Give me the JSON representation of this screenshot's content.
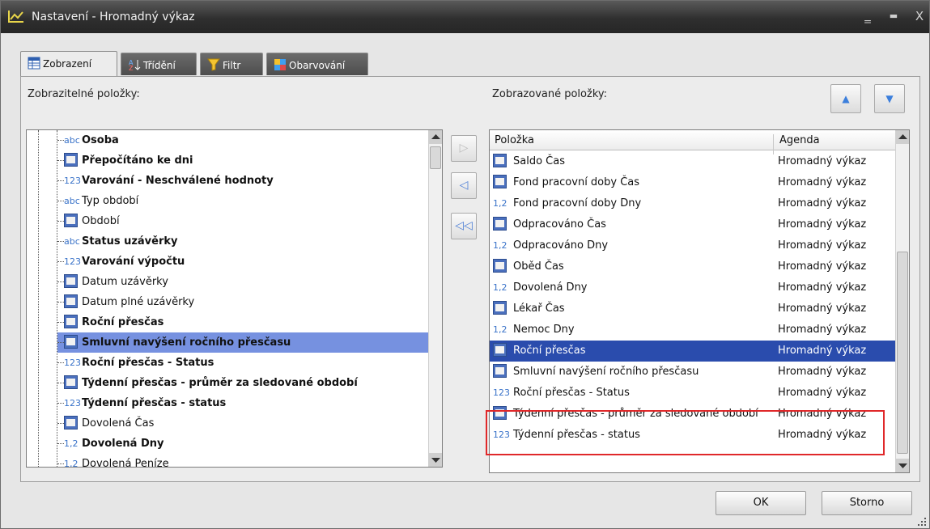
{
  "window": {
    "title": "Nastavení - Hromadný výkaz",
    "controls": {
      "minimize": "‗",
      "maximize": "▬",
      "close": "X"
    }
  },
  "tabs": [
    {
      "label": "Zobrazení",
      "icon": "table-icon",
      "active": true
    },
    {
      "label": "Třídění",
      "icon": "sort-az-icon",
      "active": false
    },
    {
      "label": "Filtr",
      "icon": "funnel-icon",
      "active": false
    },
    {
      "label": "Obarvování",
      "icon": "color-grid-icon",
      "active": false
    }
  ],
  "left": {
    "label": "Zobrazitelné položky:",
    "items": [
      {
        "icon": "abc",
        "text": "Osoba",
        "bold": true
      },
      {
        "icon": "cal",
        "text": "Přepočítáno ke dni",
        "bold": true
      },
      {
        "icon": "123",
        "text": "Varování - Neschválené hodnoty",
        "bold": true
      },
      {
        "icon": "abc",
        "text": "Typ období",
        "bold": false
      },
      {
        "icon": "cal",
        "text": "Období",
        "bold": false
      },
      {
        "icon": "abc",
        "text": "Status uzávěrky",
        "bold": true
      },
      {
        "icon": "123",
        "text": "Varování výpočtu",
        "bold": true
      },
      {
        "icon": "cal",
        "text": "Datum uzávěrky",
        "bold": false
      },
      {
        "icon": "cal",
        "text": "Datum plné uzávěrky",
        "bold": false
      },
      {
        "icon": "cal",
        "text": "Roční přesčas",
        "bold": true
      },
      {
        "icon": "cal",
        "text": "Smluvní navýšení ročního přesčasu",
        "bold": true,
        "selected": true
      },
      {
        "icon": "123",
        "text": "Roční přesčas - Status",
        "bold": true
      },
      {
        "icon": "cal",
        "text": "Týdenní přesčas - průměr za sledované období",
        "bold": true
      },
      {
        "icon": "123",
        "text": "Týdenní přesčas - status",
        "bold": true
      },
      {
        "icon": "cal",
        "text": "Dovolená Čas",
        "bold": false
      },
      {
        "icon": "1,2",
        "text": "Dovolená Dny",
        "bold": true
      },
      {
        "icon": "1,2",
        "text": "Dovolená Peníze",
        "bold": false
      }
    ]
  },
  "right": {
    "label": "Zobrazované položky:",
    "columns": [
      "Položka",
      "Agenda"
    ],
    "rows": [
      {
        "icon": "cal",
        "item": "Saldo Čas",
        "agenda": "Hromadný výkaz"
      },
      {
        "icon": "cal",
        "item": "Fond pracovní doby Čas",
        "agenda": "Hromadný výkaz"
      },
      {
        "icon": "1,2",
        "item": "Fond pracovní doby Dny",
        "agenda": "Hromadný výkaz"
      },
      {
        "icon": "cal",
        "item": "Odpracováno Čas",
        "agenda": "Hromadný výkaz"
      },
      {
        "icon": "1,2",
        "item": "Odpracováno Dny",
        "agenda": "Hromadný výkaz"
      },
      {
        "icon": "cal",
        "item": "Oběd Čas",
        "agenda": "Hromadný výkaz"
      },
      {
        "icon": "1,2",
        "item": "Dovolená Dny",
        "agenda": "Hromadný výkaz"
      },
      {
        "icon": "cal",
        "item": "Lékař Čas",
        "agenda": "Hromadný výkaz"
      },
      {
        "icon": "1,2",
        "item": "Nemoc Dny",
        "agenda": "Hromadný výkaz"
      },
      {
        "icon": "cal",
        "item": "Roční přesčas",
        "agenda": "Hromadný výkaz",
        "selected": true
      },
      {
        "icon": "cal",
        "item": "Smluvní navýšení ročního přesčasu",
        "agenda": "Hromadný výkaz"
      },
      {
        "icon": "123",
        "item": "Roční přesčas - Status",
        "agenda": "Hromadný výkaz"
      },
      {
        "icon": "cal",
        "item": "Týdenní přesčas - průměr za sledované období",
        "agenda": "Hromadný výkaz"
      },
      {
        "icon": "123",
        "item": "Týdenní přesčas - status",
        "agenda": "Hromadný výkaz"
      }
    ]
  },
  "move_buttons": {
    "add": "▷",
    "remove": "◁",
    "remove_all": "◁◁"
  },
  "order_buttons": {
    "up": "▲",
    "down": "▼"
  },
  "buttons": {
    "ok": "OK",
    "cancel": "Storno"
  },
  "colors": {
    "selection": "#2a4cad",
    "tree_selection": "#7691e0",
    "highlight_frame": "#e0282a"
  }
}
